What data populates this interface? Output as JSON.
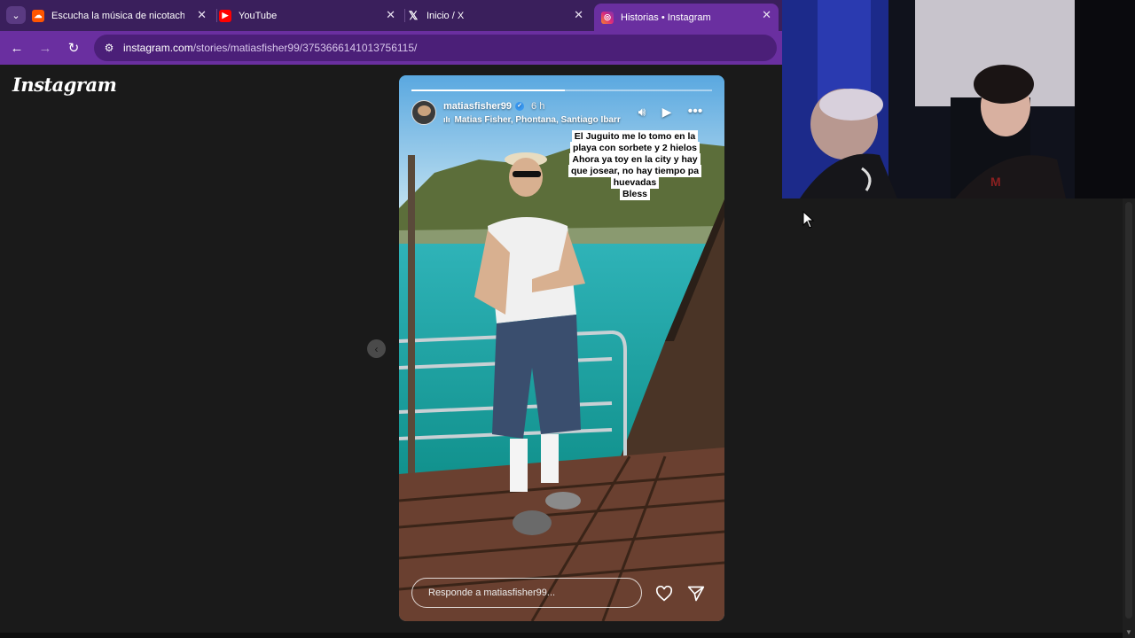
{
  "browser": {
    "tabs": [
      {
        "title": "Escucha la música de nicotachi",
        "favicon": "soundcloud-icon",
        "color": "#ff5500",
        "active": false
      },
      {
        "title": "YouTube",
        "favicon": "youtube-icon",
        "color": "#ff0000",
        "active": false
      },
      {
        "title": "Inicio / X",
        "favicon": "x-icon",
        "color": "#000000",
        "active": false
      },
      {
        "title": "Historias • Instagram",
        "favicon": "instagram-icon",
        "color": "#e1306c",
        "active": true
      }
    ],
    "url_host": "instagram.com",
    "url_path": "/stories/matiasfisher99/3753666141013756115/",
    "accent": "#6a2fa0"
  },
  "page": {
    "logo": "Instagram"
  },
  "story": {
    "username": "matiasfisher99",
    "verified": true,
    "time_ago": "6 h",
    "collaborators": "Matias Fisher, Phontana, Santiago Ibarr",
    "progress": 0.51,
    "caption_lines": [
      "El Juguito me lo tomo en la",
      "playa con sorbete y 2 hielos",
      "Ahora ya toy en la city y hay",
      "que josear, no hay tiempo pa",
      "huevadas",
      "Bless"
    ],
    "reply_placeholder": "Responde a matiasfisher99..."
  }
}
